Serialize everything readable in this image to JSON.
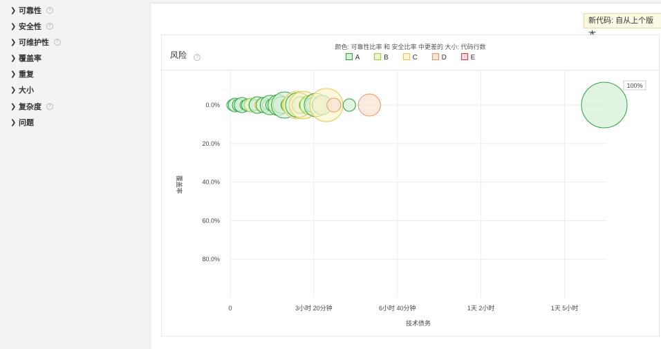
{
  "sidebar": {
    "items": [
      {
        "label": "可靠性",
        "help": true,
        "active": true
      },
      {
        "label": "安全性",
        "help": true,
        "active": false
      },
      {
        "label": "可维护性",
        "help": true,
        "active": false
      },
      {
        "label": "覆盖率",
        "help": false,
        "active": false
      },
      {
        "label": "重复",
        "help": false,
        "active": false
      },
      {
        "label": "大小",
        "help": false,
        "active": false
      },
      {
        "label": "复杂度",
        "help": true,
        "active": false
      },
      {
        "label": "问题",
        "help": false,
        "active": false
      }
    ]
  },
  "header": {
    "new_code_button": "新代码: 自从上个版本"
  },
  "panel": {
    "title": "风险",
    "legend_title": "颜色: 可靠性比率 和 安全比率 中更差的  大小: 代码行数",
    "legend": [
      {
        "label": "A",
        "fill": "#d6f0d6",
        "stroke": "#27a33a"
      },
      {
        "label": "B",
        "fill": "#eaf6c8",
        "stroke": "#9acd32"
      },
      {
        "label": "C",
        "fill": "#fdf3cd",
        "stroke": "#e8c44a"
      },
      {
        "label": "D",
        "fill": "#fde2d3",
        "stroke": "#ee8f5a"
      },
      {
        "label": "E",
        "fill": "#fbd7d9",
        "stroke": "#d4333f"
      }
    ]
  },
  "chart_data": {
    "type": "scatter",
    "subtype": "bubble",
    "xlabel": "技术债务",
    "ylabel": "覆盖率",
    "x_unit": "minutes",
    "x_ticks": [
      {
        "value": 0,
        "label": "0"
      },
      {
        "value": 200,
        "label": "3小时 20分钟"
      },
      {
        "value": 400,
        "label": "6小时 40分钟"
      },
      {
        "value": 600,
        "label": "1天 2小时"
      },
      {
        "value": 800,
        "label": "1天 5小时"
      }
    ],
    "y_ticks": [
      {
        "value": 0,
        "label": "0.0%"
      },
      {
        "value": 20,
        "label": "20.0%"
      },
      {
        "value": 40,
        "label": "40.0%"
      },
      {
        "value": 60,
        "label": "60.0%"
      },
      {
        "value": 80,
        "label": "80.0%"
      }
    ],
    "xlim": [
      0,
      900
    ],
    "ylim": [
      0,
      100
    ],
    "y_reversed": true,
    "grid": true,
    "bubble_label": "100%",
    "points": [
      {
        "x": 5,
        "y": 0,
        "r": 8,
        "rating": "A"
      },
      {
        "x": 12,
        "y": 0,
        "r": 10,
        "rating": "A"
      },
      {
        "x": 20,
        "y": 0,
        "r": 9,
        "rating": "A"
      },
      {
        "x": 28,
        "y": 0,
        "r": 11,
        "rating": "A"
      },
      {
        "x": 35,
        "y": 0,
        "r": 7,
        "rating": "A"
      },
      {
        "x": 42,
        "y": 0,
        "r": 9,
        "rating": "A"
      },
      {
        "x": 50,
        "y": 0,
        "r": 10,
        "rating": "B"
      },
      {
        "x": 58,
        "y": 0,
        "r": 8,
        "rating": "A"
      },
      {
        "x": 65,
        "y": 0,
        "r": 12,
        "rating": "A"
      },
      {
        "x": 72,
        "y": 0,
        "r": 8,
        "rating": "C"
      },
      {
        "x": 80,
        "y": 0,
        "r": 11,
        "rating": "A"
      },
      {
        "x": 88,
        "y": 0,
        "r": 7,
        "rating": "A"
      },
      {
        "x": 95,
        "y": 0,
        "r": 14,
        "rating": "A"
      },
      {
        "x": 100,
        "y": 0,
        "r": 9,
        "rating": "A"
      },
      {
        "x": 108,
        "y": 0,
        "r": 10,
        "rating": "B"
      },
      {
        "x": 115,
        "y": 0,
        "r": 15,
        "rating": "A"
      },
      {
        "x": 122,
        "y": 0,
        "r": 12,
        "rating": "A"
      },
      {
        "x": 130,
        "y": 0,
        "r": 19,
        "rating": "A"
      },
      {
        "x": 138,
        "y": 0,
        "r": 10,
        "rating": "A"
      },
      {
        "x": 145,
        "y": 0,
        "r": 13,
        "rating": "B"
      },
      {
        "x": 152,
        "y": 0,
        "r": 9,
        "rating": "C"
      },
      {
        "x": 160,
        "y": 0,
        "r": 20,
        "rating": "C"
      },
      {
        "x": 162,
        "y": 0,
        "r": 18,
        "rating": "A"
      },
      {
        "x": 168,
        "y": 0,
        "r": 12,
        "rating": "A"
      },
      {
        "x": 175,
        "y": 0,
        "r": 20,
        "rating": "C"
      },
      {
        "x": 182,
        "y": 0,
        "r": 10,
        "rating": "A"
      },
      {
        "x": 190,
        "y": 0,
        "r": 14,
        "rating": "B"
      },
      {
        "x": 198,
        "y": 0,
        "r": 11,
        "rating": "A"
      },
      {
        "x": 205,
        "y": 0,
        "r": 17,
        "rating": "A"
      },
      {
        "x": 212,
        "y": 0,
        "r": 10,
        "rating": "A"
      },
      {
        "x": 220,
        "y": 0,
        "r": 14,
        "rating": "A"
      },
      {
        "x": 230,
        "y": 0,
        "r": 24,
        "rating": "C"
      },
      {
        "x": 248,
        "y": 0,
        "r": 10,
        "rating": "D"
      },
      {
        "x": 285,
        "y": 0,
        "r": 9,
        "rating": "A"
      },
      {
        "x": 333,
        "y": 0,
        "r": 16,
        "rating": "D"
      },
      {
        "x": 895,
        "y": 0,
        "r": 33,
        "rating": "A",
        "labeled": true
      }
    ]
  }
}
